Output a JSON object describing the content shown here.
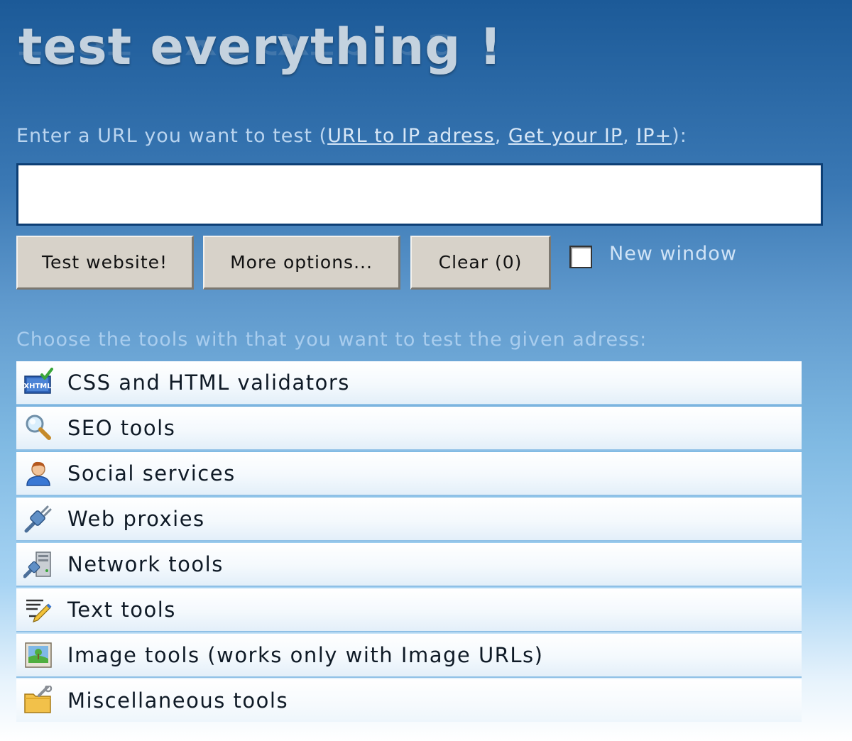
{
  "header": {
    "title": "test everything !"
  },
  "url_prompt": {
    "text_before": "Enter a URL you want to test (",
    "link1": "URL to IP adress",
    "sep1": ", ",
    "link2": "Get your IP",
    "sep2": ", ",
    "link3": "IP+",
    "text_after": "):"
  },
  "url_input": {
    "value": "",
    "placeholder": ""
  },
  "buttons": {
    "test": "Test website!",
    "more": "More options...",
    "clear": "Clear (0)"
  },
  "new_window": {
    "label": "New window",
    "checked": false
  },
  "choose_text": "Choose the tools with that you want to test the given adress:",
  "tools": [
    {
      "label": "CSS and HTML validators",
      "icon": "xhtml-validator-icon"
    },
    {
      "label": "SEO tools",
      "icon": "magnifier-icon"
    },
    {
      "label": "Social services",
      "icon": "user-icon"
    },
    {
      "label": "Web proxies",
      "icon": "plug-icon"
    },
    {
      "label": "Network tools",
      "icon": "network-server-icon"
    },
    {
      "label": "Text tools",
      "icon": "text-pencil-icon"
    },
    {
      "label": "Image tools (works only with Image URLs)",
      "icon": "picture-icon"
    },
    {
      "label": "Miscellaneous tools",
      "icon": "folder-tools-icon"
    }
  ],
  "colors": {
    "background_top": "#1c5a98",
    "background_bottom": "#ffffff",
    "link": "#d6e6f6",
    "row_border": "#8fc0e6"
  }
}
